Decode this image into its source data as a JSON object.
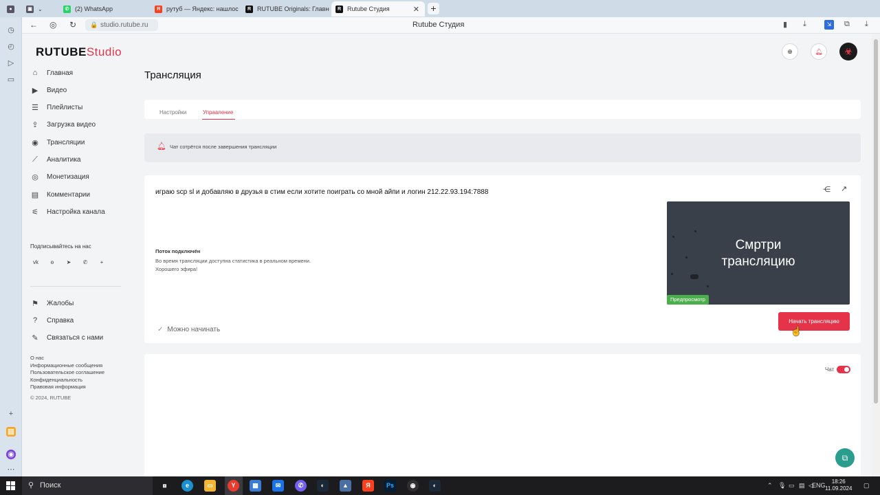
{
  "browser": {
    "tabs": [
      {
        "label": "",
        "favicon": "user-icon",
        "color": "#555"
      },
      {
        "label": "",
        "favicon": "workspaces-icon",
        "color": "#555"
      },
      {
        "label": "(2) WhatsApp",
        "favicon": "whatsapp-icon",
        "color": "#25d366"
      },
      {
        "label": "рутуб — Яндекс: нашлось",
        "favicon": "yandex-icon",
        "color": "#fc3f1d"
      },
      {
        "label": "RUTUBE Originals: Главно",
        "favicon": "rutube-icon",
        "color": "#111"
      },
      {
        "label": "Rutube Студия",
        "favicon": "rutube-icon",
        "color": "#111"
      }
    ],
    "url": "studio.rutube.ru",
    "page_title": "Rutube Студия"
  },
  "logo": {
    "main": "RUTUBE",
    "suffix": "Studio"
  },
  "sidebar": {
    "items": [
      {
        "label": "Главная",
        "icon": "home-icon"
      },
      {
        "label": "Видео",
        "icon": "video-icon"
      },
      {
        "label": "Плейлисты",
        "icon": "playlist-icon"
      },
      {
        "label": "Загрузка видео",
        "icon": "upload-icon"
      },
      {
        "label": "Трансляции",
        "icon": "broadcast-icon"
      },
      {
        "label": "Аналитика",
        "icon": "analytics-icon"
      },
      {
        "label": "Монетизация",
        "icon": "monetization-icon"
      },
      {
        "label": "Комментарии",
        "icon": "comments-icon"
      },
      {
        "label": "Настройка канала",
        "icon": "wand-icon"
      }
    ],
    "subscribe_label": "Подписывайтесь на нас",
    "socials": [
      "vk-icon",
      "ok-icon",
      "telegram-icon",
      "viber-icon",
      "more-icon"
    ],
    "bottom_items": [
      {
        "label": "Жалобы",
        "icon": "flag-icon"
      },
      {
        "label": "Справка",
        "icon": "help-icon"
      },
      {
        "label": "Связаться с нами",
        "icon": "edit-icon"
      }
    ],
    "footer_links": [
      "О нас",
      "Информационные сообщения",
      "Пользовательское соглашение",
      "Конфиденциальность",
      "Правовая информация"
    ],
    "copyright": "© 2024, RUTUBE"
  },
  "main": {
    "title": "Трансляция",
    "tabs": [
      {
        "label": "Настройки",
        "active": false
      },
      {
        "label": "Управление",
        "active": true
      }
    ],
    "alert_text": "Чат сотрётся после завершения трансляции",
    "stream": {
      "title": "играю scp sl и добавляю в друзья в стим если хотите поиграть со мной айпи и логин 212.22.93.194:7888",
      "status_heading": "Поток подключён",
      "status_line1": "Во время трансляции доступна статистика в реальном времени.",
      "status_line2": "Хорошего эфира!",
      "ready_label": "Можно начинать",
      "preview_line1": "Смртри",
      "preview_line2": "трансляцию",
      "preview_badge": "Предпросмотр",
      "start_button": "Начать трансляцию"
    },
    "chat": {
      "label": "Чат",
      "enabled": true
    }
  },
  "taskbar": {
    "search_placeholder": "Поиск",
    "lang": "ENG",
    "time": "18:26",
    "date": "11.09.2024"
  },
  "colors": {
    "accent": "#e5344a",
    "preview_bg": "#3a4049",
    "badge": "#4cae4c"
  }
}
